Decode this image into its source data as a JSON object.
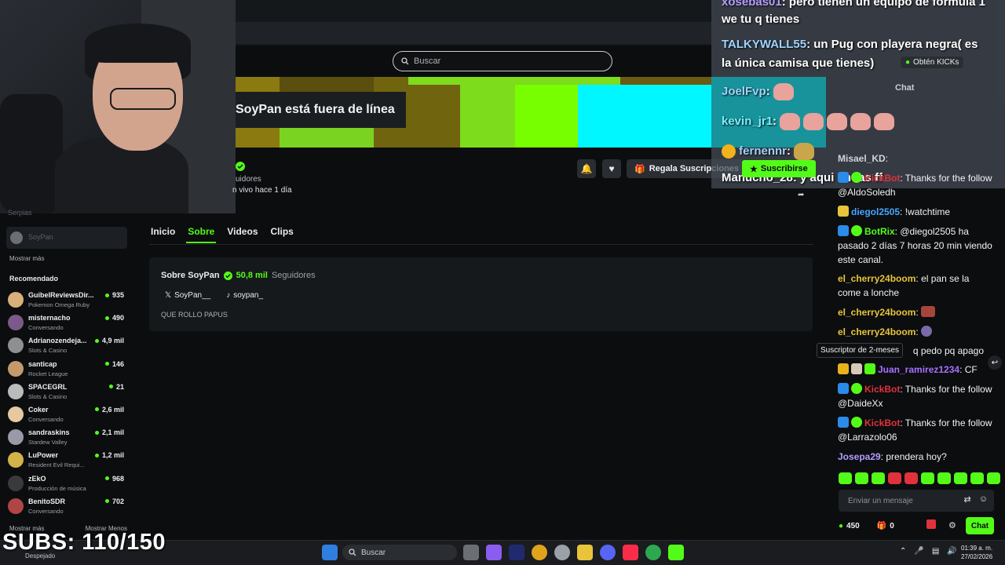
{
  "header": {
    "search_placeholder": "Buscar"
  },
  "channel": {
    "offline_text": "SoyPan está fuera de línea",
    "followers_snippet": "uidores",
    "last_live_snippet": "n vivo hace 1 día",
    "gift_label": "Regala Suscripciones",
    "subscribe_label": "Suscribirse"
  },
  "tabs": [
    {
      "label": "Inicio"
    },
    {
      "label": "Sobre"
    },
    {
      "label": "Videos"
    },
    {
      "label": "Clips"
    }
  ],
  "about": {
    "title": "Sobre SoyPan",
    "followers_count": "50,8 mil",
    "followers_label": "Seguidores",
    "socials": [
      {
        "icon": "x-icon",
        "handle": "SoyPan__"
      },
      {
        "icon": "tiktok-icon",
        "handle": "soypan_"
      }
    ],
    "description": "QUE ROLLO PAPUS"
  },
  "sidebar": {
    "faded_item": "Serpias",
    "current_item": "SoyPan",
    "show_more": "Mostrar más",
    "recommended_heading": "Recomendado",
    "recommended": [
      {
        "name": "GuibelReviewsDir...",
        "category": "Pokemon Omega Ruby",
        "viewers": "935",
        "color": "#d9b07a"
      },
      {
        "name": "misternacho",
        "category": "Conversando",
        "viewers": "490",
        "color": "#7b5a8a"
      },
      {
        "name": "Adrianozendeja...",
        "category": "Slots & Casino",
        "viewers": "4,9 mil",
        "color": "#8f8f8f"
      },
      {
        "name": "santicap",
        "category": "Rocket League",
        "viewers": "146",
        "color": "#c49a6c"
      },
      {
        "name": "SPACEGRL",
        "category": "Slots & Casino",
        "viewers": "21",
        "color": "#bbbbbb"
      },
      {
        "name": "Coker",
        "category": "Conversando",
        "viewers": "2,6 mil",
        "color": "#e6c9a0"
      },
      {
        "name": "sandraskins",
        "category": "Stardew Valley",
        "viewers": "2,1 mil",
        "color": "#9a9aa6"
      },
      {
        "name": "LuPower",
        "category": "Resident Evil Requi...",
        "viewers": "1,2 mil",
        "color": "#d4b24a"
      },
      {
        "name": "zEkO",
        "category": "Producción de música",
        "viewers": "968",
        "color": "#3a3a3a"
      },
      {
        "name": "BenitoSDR",
        "category": "Conversando",
        "viewers": "702",
        "color": "#b04545"
      }
    ],
    "show_more_bottom": "Mostrar más",
    "show_less_bottom": "Mostrar Menos",
    "weather": "Despejado"
  },
  "overlay": {
    "subs_counter": "SUBS: 110/150",
    "lines": [
      {
        "user": "xosebas01",
        "text": "pero tienen un equipo de formula 1"
      },
      {
        "user": "",
        "text": "we tu q tienes"
      },
      {
        "user": "TALKYWALL55",
        "text": "un Pug con playera negra( es"
      },
      {
        "user": "",
        "text": "la única camisa que tienes)"
      },
      {
        "user": "JoelFvp",
        "text": ""
      },
      {
        "user": "kevin_jr1",
        "text": ""
      },
      {
        "user": "fernennr",
        "text": ""
      },
      {
        "user": "Manucho_28",
        "text": "y aqui andas ff"
      }
    ],
    "kicks_label": "Obtén KICKs",
    "chat_heading": "Chat"
  },
  "chat": {
    "messages": [
      {
        "user": "Misael_KD",
        "text": "",
        "color": "#cfd4d8"
      },
      {
        "user": "KickBot",
        "text": "Thanks for the follow @AldoSoledh",
        "color": "#e0323a"
      },
      {
        "user": "diegol2505",
        "text": "!watchtime",
        "color": "#4aa6ff"
      },
      {
        "user": "BotRix",
        "text": "@diegol2505 ha pasado 2 días 7 horas 20 min viendo este canal.",
        "color": "#53fc18"
      },
      {
        "user": "el_cherry24boom",
        "text": "el pan se la come a lonche",
        "color": "#e9c43a"
      },
      {
        "user": "el_cherry24boom",
        "text": "",
        "color": "#e9c43a"
      },
      {
        "user": "el_cherry24boom",
        "text": "",
        "color": "#e9c43a"
      },
      {
        "user": "",
        "text": "q pedo pq apago",
        "color": "#e9c43a"
      },
      {
        "user": "Juan_ramirez1234",
        "text": "CF",
        "color": "#a970ff"
      },
      {
        "user": "KickBot",
        "text": "Thanks for the follow @DaideXx",
        "color": "#e0323a"
      },
      {
        "user": "KickBot",
        "text": "Thanks for the follow @Larrazolo06",
        "color": "#e0323a"
      },
      {
        "user": "Josepa29",
        "text": "prendera hoy?",
        "color": "#b49dff"
      }
    ],
    "tooltip": "Suscriptor de 2-meses",
    "input_placeholder": "Enviar un mensaje",
    "points": "450",
    "gifts": "0",
    "send_label": "Chat"
  },
  "taskbar": {
    "search_placeholder": "Buscar",
    "time": "01:39 a. m.",
    "date": "27/02/2026"
  }
}
